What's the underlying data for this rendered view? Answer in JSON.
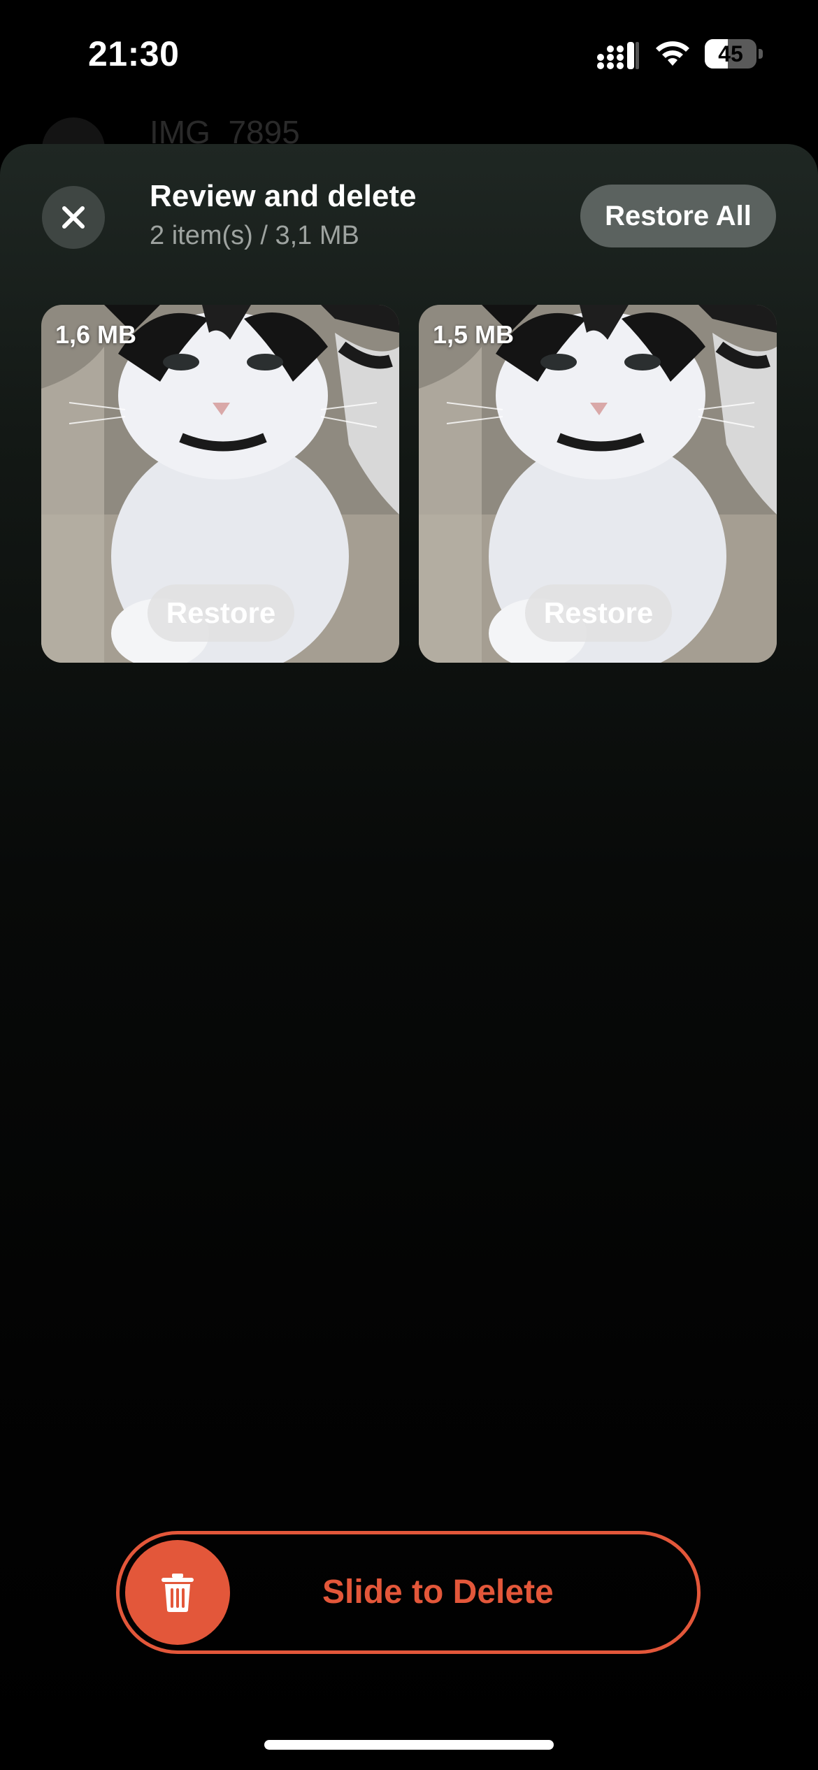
{
  "status_bar": {
    "time": "21:30",
    "battery_level": "45",
    "battery_fraction": 0.45
  },
  "background_page": {
    "title": "IMG_7895"
  },
  "sheet": {
    "title": "Review and delete",
    "subtitle": "2 item(s) / 3,1 MB",
    "restore_all_label": "Restore All",
    "items": [
      {
        "size": "1,6 MB",
        "restore_label": "Restore"
      },
      {
        "size": "1,5 MB",
        "restore_label": "Restore"
      }
    ]
  },
  "slide_to_delete": {
    "label": "Slide to Delete",
    "accent_color": "#e3573a"
  },
  "icons": {
    "close": "close-icon",
    "trash": "trash-icon",
    "signal": "cellular-signal-icon",
    "wifi": "wifi-icon",
    "battery": "battery-icon"
  }
}
